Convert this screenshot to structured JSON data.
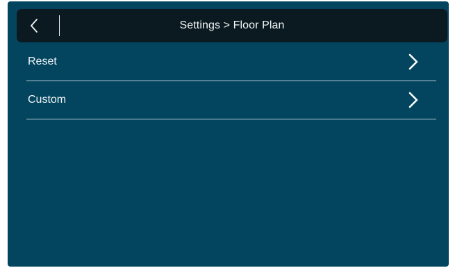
{
  "header": {
    "title": "Settings > Floor Plan",
    "back_icon": "chevron-left-icon"
  },
  "menu": {
    "items": [
      {
        "label": "Reset",
        "icon": "chevron-right-icon"
      },
      {
        "label": "Custom",
        "icon": "chevron-right-icon"
      }
    ]
  },
  "colors": {
    "background": "#03455f",
    "header_bar": "#0b1a20",
    "text": "#f2f6f8",
    "divider": "#b9ccd4"
  }
}
